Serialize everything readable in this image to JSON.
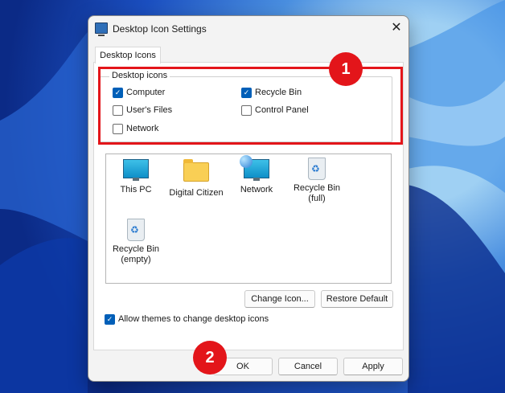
{
  "dialog": {
    "title": "Desktop Icon Settings",
    "close_glyph": "✕"
  },
  "tab": {
    "label": "Desktop Icons"
  },
  "group": {
    "title": "Desktop icons",
    "items": [
      {
        "label": "Computer",
        "checked": true
      },
      {
        "label": "Recycle Bin",
        "checked": true
      },
      {
        "label": "User's Files",
        "checked": false
      },
      {
        "label": "Control Panel",
        "checked": false
      },
      {
        "label": "Network",
        "checked": false
      }
    ]
  },
  "icons": [
    {
      "label": "This PC",
      "icon": "monitor-icon"
    },
    {
      "label": "Digital Citizen",
      "icon": "folder-icon"
    },
    {
      "label": "Network",
      "icon": "network-icon"
    },
    {
      "label": "Recycle Bin\n(full)",
      "icon": "recycle-bin-full-icon"
    },
    {
      "label": "Recycle Bin\n(empty)",
      "icon": "recycle-bin-empty-icon"
    }
  ],
  "buttons": {
    "change_icon": "Change Icon...",
    "restore_default": "Restore Default",
    "ok": "OK",
    "cancel": "Cancel",
    "apply": "Apply"
  },
  "allow_themes": {
    "label": "Allow themes to change desktop icons",
    "checked": true
  },
  "annotations": {
    "badge_1": "1",
    "badge_2": "2"
  },
  "colors": {
    "accent": "#005fb8",
    "annotation_red": "#e3151a"
  }
}
